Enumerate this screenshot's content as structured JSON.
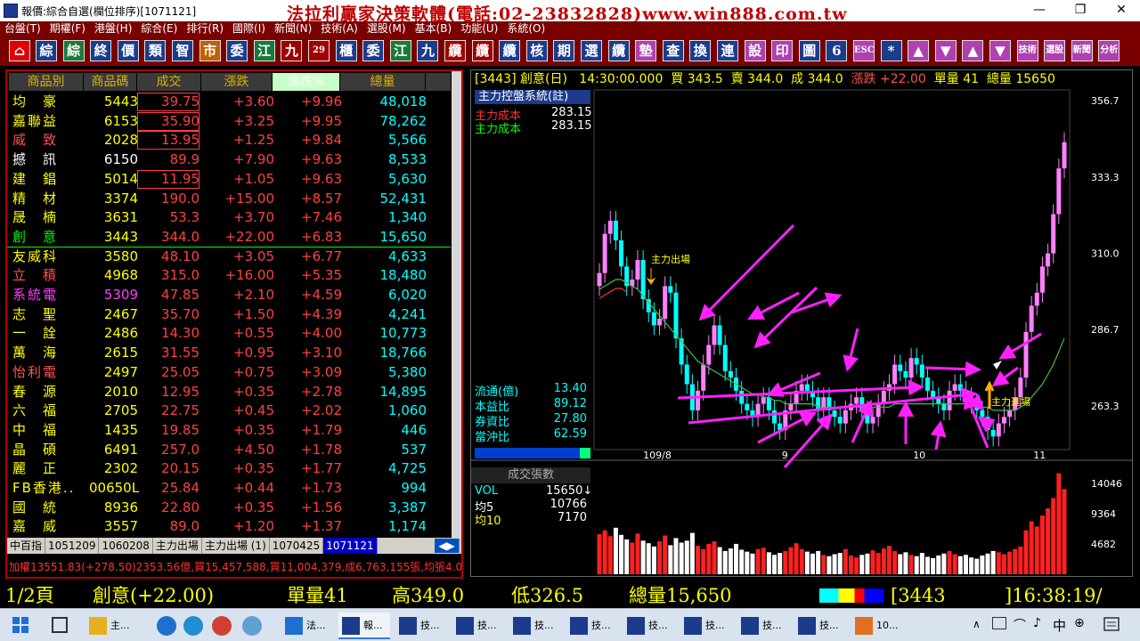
{
  "window": {
    "title": "報價:綜合自選(欄位排序)[1071121]",
    "ad": "法拉利贏家決策軟體(電話:02-23832828)www.win888.com.tw",
    "controls": {
      "minimize": "—",
      "maximize": "❐",
      "close": "✕"
    }
  },
  "menu": [
    "台盤(T)",
    "期權(F)",
    "港盤(H)",
    "綜合(E)",
    "排行(R)",
    "國際(I)",
    "新聞(N)",
    "技術(A)",
    "選股(M)",
    "基本(B)",
    "功能(U)",
    "系統(O)"
  ],
  "toolbar": [
    "綜",
    "綜",
    "終",
    "價",
    "類",
    "智",
    "市",
    "委",
    "江",
    "九",
    "29",
    "櫃",
    "委",
    "江",
    "九",
    "纜",
    "纜",
    "纜",
    "核",
    "期",
    "選",
    "纜",
    "墊",
    "查",
    "換",
    "連",
    "設",
    "印",
    "圖",
    "6",
    "ESC",
    "*",
    "▲",
    "▼",
    "▲",
    "▼",
    "技術",
    "選股",
    "新聞",
    "分析"
  ],
  "table": {
    "headers": [
      "商品別",
      "商品碼",
      "成交",
      "漲跌",
      "漲跌%",
      "總量"
    ],
    "rows": [
      {
        "name": "均　豪",
        "code": "5443",
        "price": "39.75",
        "chg": "+3.60",
        "pct": "+9.96",
        "vol": "48,018",
        "boxed": true,
        "color": "#ffff00"
      },
      {
        "name": "嘉聯益",
        "code": "6153",
        "price": "35.90",
        "chg": "+3.25",
        "pct": "+9.95",
        "vol": "78,262",
        "boxed": true,
        "color": "#ffff00"
      },
      {
        "name": "威　致",
        "code": "2028",
        "price": "13.95",
        "chg": "+1.25",
        "pct": "+9.84",
        "vol": "5,566",
        "boxed": true,
        "color": "#ff5050"
      },
      {
        "name": "撼　訊",
        "code": "6150",
        "price": "89.9",
        "chg": "+7.90",
        "pct": "+9.63",
        "vol": "8,533",
        "boxed": false,
        "color": "#ffffff"
      },
      {
        "name": "建　錩",
        "code": "5014",
        "price": "11.95",
        "chg": "+1.05",
        "pct": "+9.63",
        "vol": "5,630",
        "boxed": true,
        "color": "#ffff00"
      },
      {
        "name": "精　材",
        "code": "3374",
        "price": "190.0",
        "chg": "+15.00",
        "pct": "+8.57",
        "vol": "52,431",
        "boxed": false,
        "color": "#ffff00"
      },
      {
        "name": "晟　楠",
        "code": "3631",
        "price": "53.3",
        "chg": "+3.70",
        "pct": "+7.46",
        "vol": "1,340",
        "boxed": false,
        "color": "#ffff00"
      },
      {
        "name": "創　意",
        "code": "3443",
        "price": "344.0",
        "chg": "+22.00",
        "pct": "+6.83",
        "vol": "15,650",
        "boxed": false,
        "color": "#00ff00"
      },
      {
        "name": "友威科",
        "code": "3580",
        "price": "48.10",
        "chg": "+3.05",
        "pct": "+6.77",
        "vol": "4,633",
        "boxed": false,
        "color": "#ffff00"
      },
      {
        "name": "立　積",
        "code": "4968",
        "price": "315.0",
        "chg": "+16.00",
        "pct": "+5.35",
        "vol": "18,480",
        "boxed": false,
        "color": "#ff5050"
      },
      {
        "name": "系統電",
        "code": "5309",
        "price": "47.85",
        "chg": "+2.10",
        "pct": "+4.59",
        "vol": "6,020",
        "boxed": false,
        "color": "#ff40ff"
      },
      {
        "name": "志　聖",
        "code": "2467",
        "price": "35.70",
        "chg": "+1.50",
        "pct": "+4.39",
        "vol": "4,241",
        "boxed": false,
        "color": "#ffff00"
      },
      {
        "name": "一　詮",
        "code": "2486",
        "price": "14.30",
        "chg": "+0.55",
        "pct": "+4.00",
        "vol": "10,773",
        "boxed": false,
        "color": "#ffff00"
      },
      {
        "name": "萬　海",
        "code": "2615",
        "price": "31.55",
        "chg": "+0.95",
        "pct": "+3.10",
        "vol": "18,766",
        "boxed": false,
        "color": "#ffff00"
      },
      {
        "name": "怡利電",
        "code": "2497",
        "price": "25.05",
        "chg": "+0.75",
        "pct": "+3.09",
        "vol": "5,380",
        "boxed": false,
        "color": "#ff5050"
      },
      {
        "name": "春　源",
        "code": "2010",
        "price": "12.95",
        "chg": "+0.35",
        "pct": "+2.78",
        "vol": "14,895",
        "boxed": false,
        "color": "#ffff00"
      },
      {
        "name": "六　福",
        "code": "2705",
        "price": "22.75",
        "chg": "+0.45",
        "pct": "+2.02",
        "vol": "1,060",
        "boxed": false,
        "color": "#ffff00"
      },
      {
        "name": "中　福",
        "code": "1435",
        "price": "19.85",
        "chg": "+0.35",
        "pct": "+1.79",
        "vol": "446",
        "boxed": false,
        "color": "#ffff00"
      },
      {
        "name": "晶　碩",
        "code": "6491",
        "price": "257.0",
        "chg": "+4.50",
        "pct": "+1.78",
        "vol": "537",
        "boxed": false,
        "color": "#ffff00"
      },
      {
        "name": "麗　正",
        "code": "2302",
        "price": "20.15",
        "chg": "+0.35",
        "pct": "+1.77",
        "vol": "4,725",
        "boxed": false,
        "color": "#ffff00"
      },
      {
        "name": "FB香港..",
        "code": "00650L",
        "price": "25.84",
        "chg": "+0.44",
        "pct": "+1.73",
        "vol": "994",
        "boxed": false,
        "color": "#ffff00"
      },
      {
        "name": "國　統",
        "code": "8936",
        "price": "22.80",
        "chg": "+0.35",
        "pct": "+1.56",
        "vol": "3,387",
        "boxed": false,
        "color": "#ffff00"
      },
      {
        "name": "嘉　威",
        "code": "3557",
        "price": "89.0",
        "chg": "+1.20",
        "pct": "+1.37",
        "vol": "1,174",
        "boxed": false,
        "color": "#ffff00"
      }
    ],
    "tabs": [
      "中百指",
      "1051209",
      "1060208",
      "主力出場",
      "主力出場 (1)",
      "1070425",
      "1071121"
    ],
    "status": "加權13551.83(+278.50)2353.56億,買15,457,588,買11,004,379,成6,763,155張,均張4.0"
  },
  "chart": {
    "header": {
      "code": "[3443] 創意(日)",
      "time": "14:30:00.000",
      "bid": "買 343.5",
      "ask": "賣 344.0",
      "deal": "成 344.0",
      "chg": "漲跌 +22.00",
      "lot": "單量 41",
      "total": "總量 15650"
    },
    "indicator": "主力控盤系統(註)",
    "legend": [
      {
        "label": "主力成本",
        "value": "283.15",
        "color": "#ff3030"
      },
      {
        "label": "主力成本",
        "value": "283.15",
        "color": "#00ff00"
      }
    ],
    "stats": [
      {
        "label": "流通(億)",
        "value": "13.40"
      },
      {
        "label": "本益比",
        "value": "89.12"
      },
      {
        "label": "券資比",
        "value": "27.80"
      },
      {
        "label": "當沖比",
        "value": "62.59"
      }
    ],
    "annotations": [
      "主力出場",
      "主力進場"
    ],
    "vol_title": "成交張數",
    "vol_legend": [
      {
        "label": "VOL",
        "value": "15650↓"
      },
      {
        "label": "均5",
        "value": "10766"
      },
      {
        "label": "均10",
        "value": "7170"
      }
    ],
    "y_ticks": [
      "356.7",
      "333.3",
      "310.0",
      "286.7",
      "263.3"
    ],
    "vol_ticks": [
      "14046",
      "9364",
      "4682"
    ],
    "x_ticks": [
      "109/8",
      "9",
      "10",
      "11"
    ]
  },
  "chart_data": {
    "type": "candlestick",
    "ylim": [
      250,
      360
    ],
    "y_ticks": [
      356.7,
      333.3,
      310.0,
      286.7,
      263.3
    ],
    "x_ticks": [
      "109/8",
      "9",
      "10",
      "11"
    ],
    "close": [
      304,
      316,
      320,
      314,
      306,
      300,
      302,
      308,
      296,
      292,
      288,
      290,
      300,
      298,
      284,
      276,
      270,
      262,
      268,
      276,
      282,
      288,
      282,
      274,
      272,
      268,
      264,
      262,
      260,
      264,
      266,
      262,
      258,
      256,
      262,
      264,
      268,
      270,
      268,
      266,
      262,
      266,
      262,
      260,
      258,
      262,
      264,
      266,
      262,
      258,
      260,
      264,
      268,
      270,
      276,
      274,
      272,
      278,
      276,
      272,
      268,
      266,
      264,
      262,
      268,
      270,
      268,
      266,
      264,
      262,
      260,
      256,
      254,
      258,
      260,
      262,
      266,
      272,
      286,
      294,
      298,
      306,
      310,
      322,
      336,
      344
    ],
    "volume": [
      6200,
      6800,
      5900,
      7200,
      6100,
      5400,
      4900,
      6300,
      5200,
      4800,
      4300,
      5100,
      6000,
      4500,
      5600,
      4900,
      5200,
      6400,
      4400,
      3900,
      4700,
      5100,
      4200,
      3600,
      4000,
      4700,
      3800,
      3500,
      3200,
      3900,
      4100,
      3400,
      3000,
      3300,
      3600,
      4200,
      4800,
      3900,
      3500,
      3200,
      3600,
      3000,
      2800,
      3100,
      3300,
      3900,
      2900,
      2600,
      3000,
      3200,
      3700,
      3300,
      4000,
      4400,
      3600,
      3100,
      3400,
      3000,
      2800,
      3300,
      2700,
      2500,
      2900,
      3200,
      3600,
      3100,
      2800,
      3000,
      2600,
      2400,
      2900,
      3200,
      3600,
      3400,
      3100,
      3500,
      3900,
      4300,
      6800,
      8200,
      7400,
      9100,
      10200,
      11800,
      15650,
      13200
    ],
    "ma": [
      299,
      300,
      301,
      302,
      302,
      301,
      300,
      299,
      297,
      295,
      293,
      291,
      289,
      287,
      285,
      283,
      281,
      279,
      277,
      276,
      275,
      274,
      273,
      272,
      271,
      270,
      269,
      268,
      267,
      267,
      266,
      266,
      265,
      265,
      264,
      264,
      264,
      264,
      264,
      264,
      263,
      263,
      263,
      263,
      263,
      263,
      263,
      263,
      263,
      263,
      263,
      263,
      263,
      263,
      264,
      264,
      264,
      264,
      264,
      264,
      264,
      264,
      264,
      264,
      264,
      264,
      264,
      264,
      264,
      264,
      263,
      263,
      262,
      262,
      262,
      262,
      262,
      263,
      264,
      266,
      268,
      270,
      273,
      276,
      280,
      284
    ]
  },
  "ticker": {
    "page": "1/2頁",
    "name": "創意(+22.00)",
    "lot": "單量41",
    "high": "高349.0",
    "low": "低326.5",
    "total": "總量15,650",
    "code": "[3443",
    "time": "]16:38:19/"
  },
  "taskbar": [
    "主...",
    "法...",
    "報...",
    "技...",
    "技...",
    "技...",
    "技...",
    "技...",
    "技...",
    "技...",
    "技...",
    "10..."
  ],
  "tray": {
    "lang": "中",
    "extra": "⊕"
  }
}
